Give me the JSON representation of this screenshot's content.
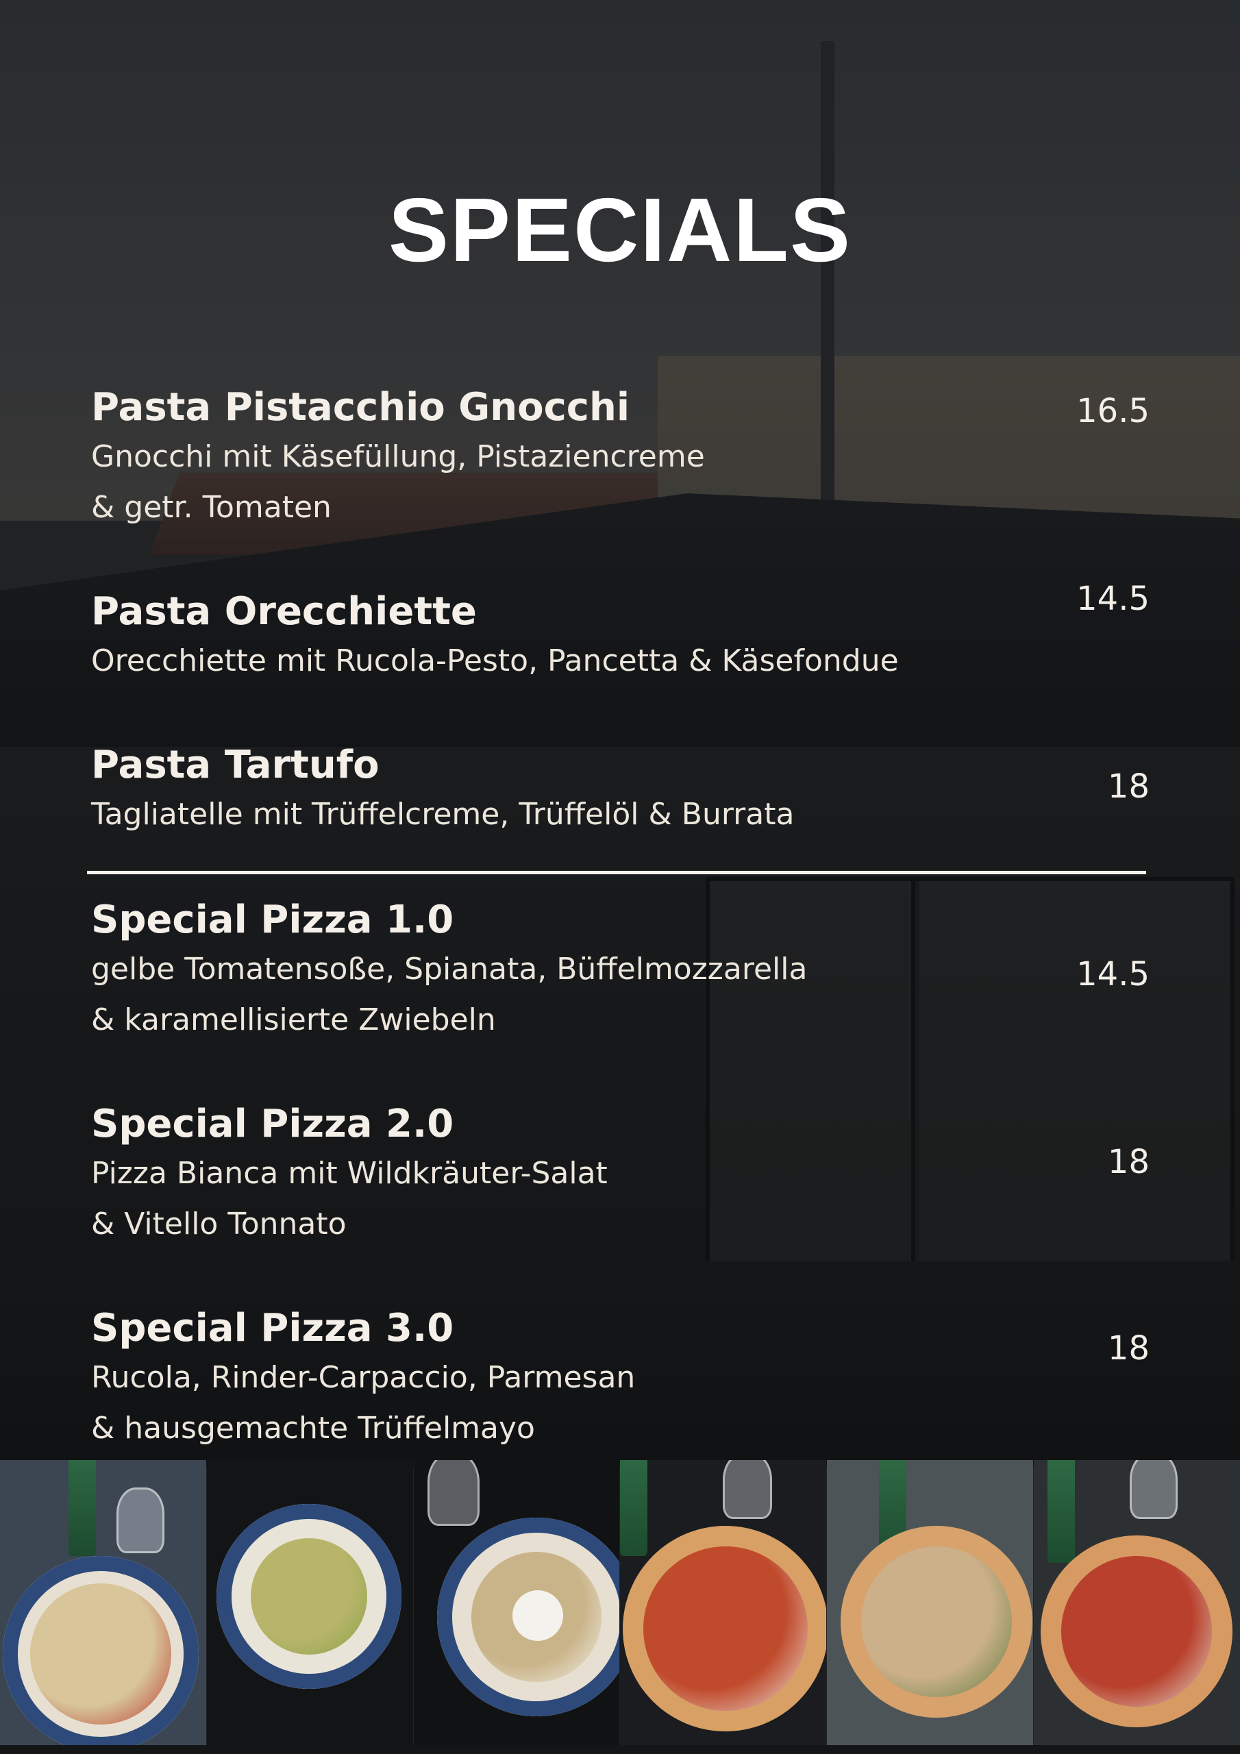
{
  "title": "SPECIALS",
  "items": [
    {
      "name": "Pasta Pistacchio Gnocchi",
      "desc": [
        "Gnocchi mit Käsefüllung, Pistaziencreme",
        "& getr. Tomaten"
      ],
      "price": "16.5"
    },
    {
      "name": "Pasta Orecchiette",
      "desc": [
        "Orecchiette mit Rucola-Pesto, Pancetta & Käsefondue"
      ],
      "price": "14.5"
    },
    {
      "name": "Pasta Tartufo",
      "desc": [
        "Tagliatelle mit Trüffelcreme, Trüffelöl & Burrata"
      ],
      "price": "18"
    },
    {
      "name": "Special Pizza 1.0",
      "desc": [
        "gelbe Tomatensoße, Spianata, Büffelmozzarella",
        "& karamellisierte Zwiebeln"
      ],
      "price": "14.5"
    },
    {
      "name": "Special Pizza 2.0",
      "desc": [
        "Pizza Bianca mit Wildkräuter-Salat",
        "& Vitello Tonnato"
      ],
      "price": "18"
    },
    {
      "name": "Special Pizza 3.0",
      "desc": [
        "Rucola, Rinder-Carpaccio, Parmesan",
        "& hausgemachte Trüffelmayo"
      ],
      "price": "18"
    }
  ],
  "photos": [
    {
      "subject": "gnocchi-plate",
      "colors": {
        "bg": "#3b4652",
        "plate": "#e7e0d2",
        "food": "#d8c69a",
        "accent": "#b8332a"
      }
    },
    {
      "subject": "orecchiette-plate",
      "colors": {
        "bg": "#121416",
        "plate": "#e9e4d8",
        "food": "#b8b56a",
        "accent": "#8aa24a"
      }
    },
    {
      "subject": "tartufo-plate",
      "colors": {
        "bg": "#101214",
        "plate": "#e6dfd2",
        "food": "#c9b489",
        "accent": "#f4f2ec"
      }
    },
    {
      "subject": "pizza-1",
      "colors": {
        "bg": "#1a1c1f",
        "plate": "#d9a066",
        "food": "#c04a2c",
        "accent": "#f0ece2"
      }
    },
    {
      "subject": "pizza-2",
      "colors": {
        "bg": "#4d5457",
        "plate": "#d7a26c",
        "food": "#cbb08a",
        "accent": "#5d7a3a"
      }
    },
    {
      "subject": "pizza-3",
      "colors": {
        "bg": "#2c3033",
        "plate": "#d69a62",
        "food": "#b8402c",
        "accent": "#e9e4d8"
      }
    }
  ]
}
